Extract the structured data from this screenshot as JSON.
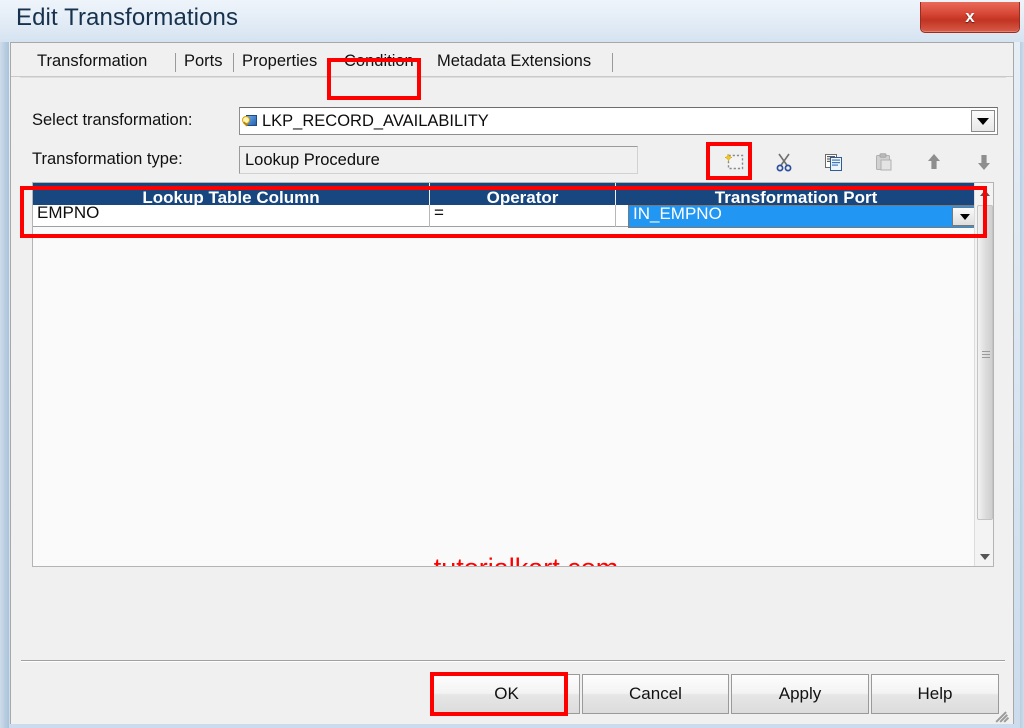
{
  "window": {
    "title": "Edit Transformations",
    "close_label": "x",
    "close_icon": "close-icon"
  },
  "tabs": [
    {
      "label": "Transformation",
      "selected": false
    },
    {
      "label": "Ports",
      "selected": false
    },
    {
      "label": "Properties",
      "selected": false
    },
    {
      "label": "Condition",
      "selected": true
    },
    {
      "label": "Metadata Extensions",
      "selected": false
    }
  ],
  "form": {
    "select_transformation_label": "Select transformation:",
    "select_transformation_value": "LKP_RECORD_AVAILABILITY",
    "select_transformation_icon": "lookup-transformation-icon",
    "select_transformation_arrow_icon": "chevron-down-icon",
    "transformation_type_label": "Transformation type:",
    "transformation_type_value": "Lookup Procedure"
  },
  "toolbar": [
    {
      "name": "new-condition-button",
      "icon": "new-row-icon",
      "enabled": true
    },
    {
      "name": "cut-button",
      "icon": "scissors-icon",
      "enabled": true
    },
    {
      "name": "copy-button",
      "icon": "copy-icon",
      "enabled": true
    },
    {
      "name": "paste-button",
      "icon": "paste-icon",
      "enabled": false
    },
    {
      "name": "move-up-button",
      "icon": "arrow-up-icon",
      "enabled": true
    },
    {
      "name": "move-down-button",
      "icon": "arrow-down-icon",
      "enabled": true
    }
  ],
  "grid": {
    "columns": [
      "Lookup Table Column",
      "Operator",
      "Transformation Port"
    ],
    "rows": [
      {
        "lookup_table_column": "EMPNO",
        "operator": "=",
        "transformation_port": "IN_EMPNO"
      }
    ],
    "port_dropdown_icon": "chevron-down-icon",
    "scrollbar": {
      "up_icon": "scroll-up-icon",
      "down_icon": "scroll-down-icon"
    }
  },
  "watermark": "tutorialkart.com",
  "buttons": [
    {
      "label": "OK",
      "highlighted": true
    },
    {
      "label": "Cancel",
      "highlighted": false
    },
    {
      "label": "Apply",
      "highlighted": false
    },
    {
      "label": "Help",
      "highlighted": false
    }
  ],
  "colors": {
    "header_blue": "#17477e",
    "selection_blue": "#2196f3",
    "annotation_red": "#ff0000",
    "watermark_red": "#ff0000",
    "close_red": "#d74634"
  }
}
